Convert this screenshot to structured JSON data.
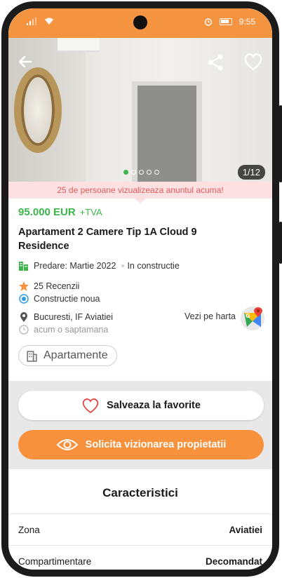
{
  "status_bar": {
    "time": "9:55"
  },
  "gallery": {
    "counter": "1/12",
    "dots": 5,
    "active_dot": 0
  },
  "viewers_banner": "25 de persoane vizualizeaza anuntul acuma!",
  "listing": {
    "price": "95.000 EUR",
    "vat": "+TVA",
    "title": "Apartament 2 Camere Tip 1A Cloud 9 Residence",
    "delivery": "Predare: Martie 2022",
    "status": "In constructie",
    "reviews": "25 Recenzii",
    "construction": "Constructie noua",
    "location": "Bucuresti, IF Aviatiei",
    "map_link": "Vezi pe harta",
    "posted": "acum o saptamana",
    "category_chip": "Apartamente"
  },
  "actions": {
    "favorite_label": "Salveaza la favorite",
    "viewing_label": "Solicita vizionarea propietatii"
  },
  "specs": {
    "title": "Caracteristici",
    "rows": [
      {
        "label": "Zona",
        "value": "Aviatiei"
      },
      {
        "label": "Compartimentare",
        "value": "Decomandat"
      }
    ]
  },
  "colors": {
    "accent": "#f7913b",
    "price": "#3cb54a",
    "banner_bg": "#fde0e1",
    "banner_text": "#e05a5a"
  }
}
